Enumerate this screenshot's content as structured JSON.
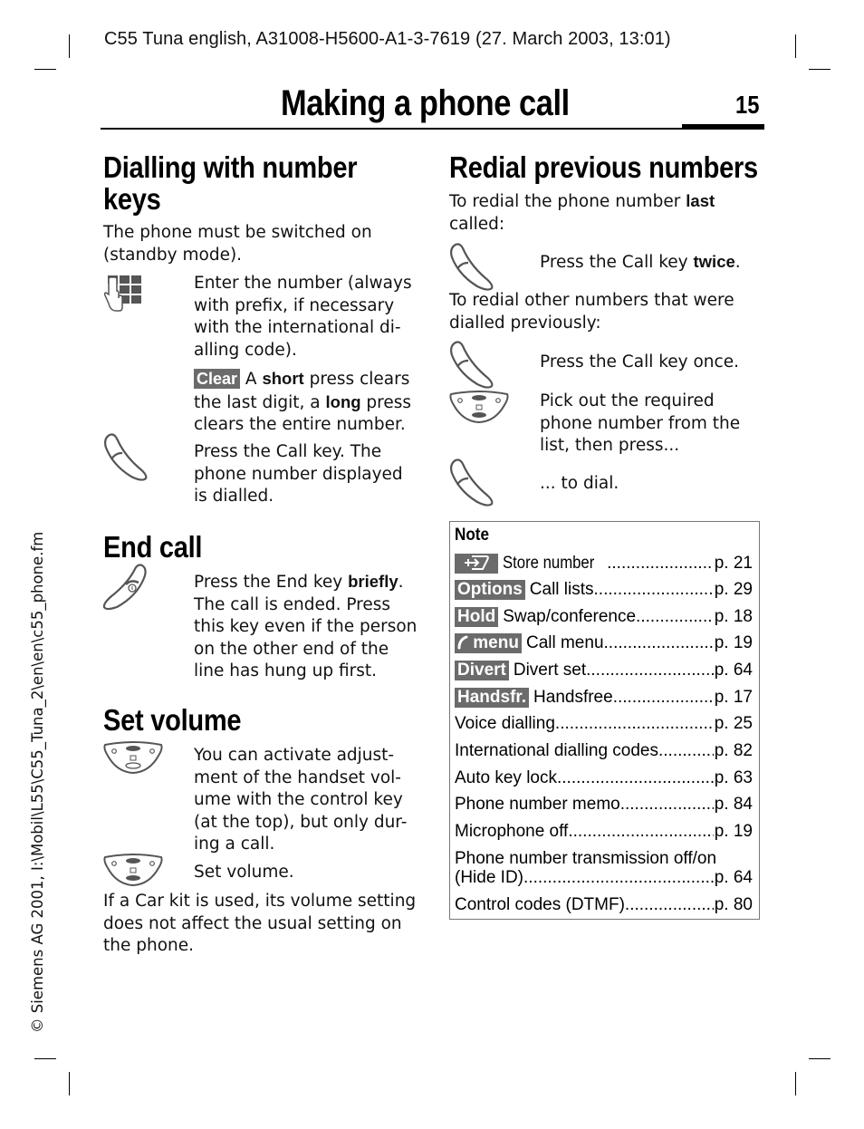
{
  "header": {
    "doc_info": "C55 Tuna english, A31008-H5600-A1-3-7619 (27. March 2003, 13:01)",
    "page_title": "Making a phone call",
    "page_number": "15"
  },
  "side_margin": "© Siemens AG 2001, I:\\Mobil\\L55\\C55_Tuna_2\\en\\en\\c55_phone.fm",
  "left_column": {
    "dialling": {
      "heading_line1": "Dialling with number",
      "heading_line2": "keys",
      "intro_line1": "The phone must be switched on",
      "intro_line2": "(standby mode).",
      "steps": [
        {
          "icon": "keypad-icon",
          "lines": [
            "Enter the number (always",
            "with prefix, if necessary",
            "with the international di-",
            "alling code)."
          ]
        },
        {
          "softkey": "Clear",
          "t1": " A ",
          "b1": "short",
          "t2": " press clears",
          "line2a": "the last digit, a ",
          "b2": "long",
          "line2b": " press",
          "line3": "clears the entire number."
        },
        {
          "icon": "call-key-icon",
          "lines": [
            "Press the Call key. The",
            "phone number displayed",
            "is dialled."
          ]
        }
      ]
    },
    "end_call": {
      "heading": "End call",
      "icon": "end-key-icon",
      "line1_text": "Press the End key ",
      "line1_bold": "briefly",
      "line1_end": ".",
      "lines": [
        "The call is ended. Press",
        "this key even if the person",
        "on the other end of the",
        "line has hung up first."
      ]
    },
    "set_volume": {
      "heading": "Set volume",
      "steps": [
        {
          "icon": "control-key-top-icon",
          "lines": [
            "You can activate adjust-",
            "ment of the handset vol-",
            "ume with the control key",
            "(at the top), but only dur-",
            "ing a call."
          ]
        },
        {
          "icon": "control-key-icon",
          "lines": [
            "Set volume."
          ]
        }
      ],
      "footer_lines": [
        "If a Car kit is used, its volume setting",
        "does not affect the usual setting on",
        "the phone."
      ]
    }
  },
  "right_column": {
    "redial": {
      "heading": "Redial previous numbers",
      "intro_text": "To redial the phone number ",
      "intro_bold": "last",
      "intro_line2": "called:",
      "step1_text": "Press the Call key ",
      "step1_bold": "twice",
      "step1_end": ".",
      "other_line1": "To redial other numbers that were",
      "other_line2": "dialled previously:",
      "step2": "Press the Call key once.",
      "step3_lines": [
        "Pick out the required",
        "phone number from the",
        "list, then press..."
      ],
      "step4": "... to dial."
    },
    "note": {
      "title": "Note",
      "rows": [
        {
          "key": "store-icon",
          "label": "Store number",
          "page": "p. 21"
        },
        {
          "key": "Options",
          "label": "Call lists",
          "page": "p. 29"
        },
        {
          "key": "Hold",
          "label": "Swap/conference",
          "page": "p. 18"
        },
        {
          "key": "menu",
          "key_icon": "handset-icon",
          "label": "Call menu",
          "page": "p. 19"
        },
        {
          "key": "Divert",
          "label": "Divert set",
          "page": "p. 64"
        },
        {
          "key": "Handsfr.",
          "label": "Handsfree",
          "page": "p. 17"
        },
        {
          "label": "Voice dialling",
          "page": "p. 25"
        },
        {
          "label": "International dialling codes",
          "page": "p. 82"
        },
        {
          "label": "Auto key lock",
          "page": "p. 63"
        },
        {
          "label": "Phone number memo",
          "page": "p. 84"
        },
        {
          "label": "Microphone off",
          "page": "p. 19"
        },
        {
          "label_line1": "Phone number transmission off/on",
          "label": "(Hide ID)",
          "page": "p. 64"
        },
        {
          "label": "Control codes (DTMF)",
          "page": "p. 80"
        }
      ]
    }
  }
}
